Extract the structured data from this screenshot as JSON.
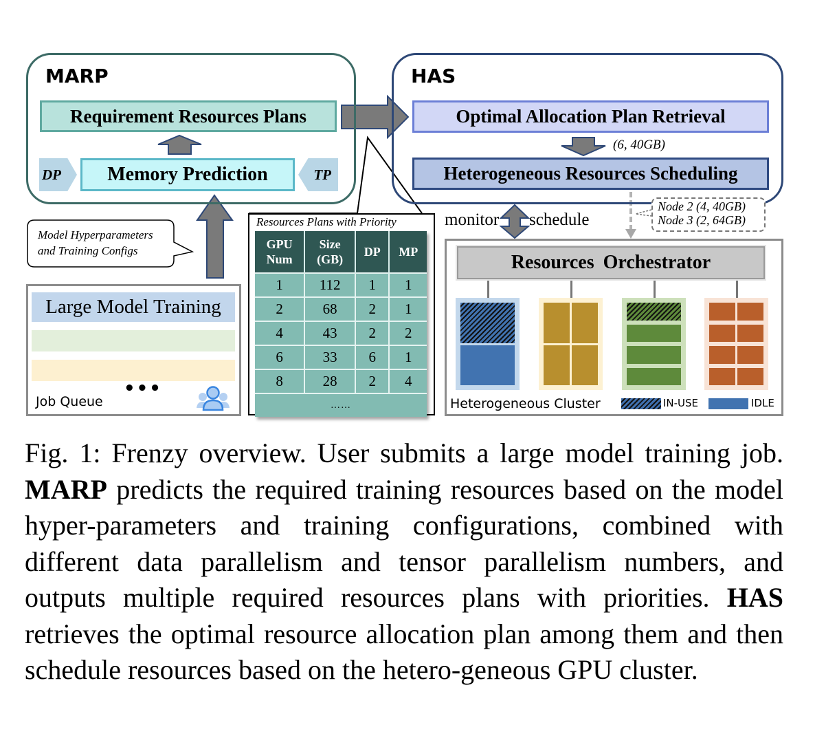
{
  "marp": {
    "title": "MARP",
    "requirement_plans": "Requirement Resources Plans",
    "memory_prediction": "Memory Prediction",
    "dp_tag": "DP",
    "tp_tag": "TP"
  },
  "has": {
    "title": "HAS",
    "optimal_plan": "Optimal Allocation Plan Retrieval",
    "selected_plan": "(6, 40GB)",
    "scheduling": "Heterogeneous Resources Scheduling"
  },
  "input_callout": {
    "line1": "Model Hyperparameters",
    "line2": "and Training Configs"
  },
  "job_queue": {
    "label": "Job Queue",
    "first_job": "Large Model Training",
    "more": "•••",
    "icon": "users-icon",
    "row_colors": [
      "#c2d6ec",
      "#e3efdb",
      "#fdf0d0"
    ]
  },
  "plans_table": {
    "caption": "Resources Plans with Priority",
    "headers": [
      [
        "GPU",
        "Num"
      ],
      [
        "Size",
        "(GB)"
      ],
      [
        "DP"
      ],
      [
        "MP"
      ]
    ],
    "rows": [
      [
        "1",
        "112",
        "1",
        "1"
      ],
      [
        "2",
        "68",
        "2",
        "1"
      ],
      [
        "4",
        "43",
        "2",
        "2"
      ],
      [
        "6",
        "33",
        "6",
        "1"
      ],
      [
        "8",
        "28",
        "2",
        "4"
      ]
    ],
    "more": "……"
  },
  "interaction": {
    "monitor": "monitor",
    "schedule": "schedule",
    "node_assignments": [
      "Node 2 (4, 40GB)",
      "Node 3 (2, 64GB)"
    ]
  },
  "cluster": {
    "orchestrator": "Resources  Orchestrator",
    "label": "Heterogeneous Cluster",
    "legend": {
      "in_use": "IN-USE",
      "idle": "IDLE"
    },
    "nodes": [
      {
        "name": "node-blue",
        "bg": "#c3d8ec",
        "color": "#4173b0",
        "cells": 2,
        "in_use": 1
      },
      {
        "name": "node-gold",
        "bg": "#fdf1d2",
        "color": "#b88f2e",
        "cells": 4,
        "in_use": 0
      },
      {
        "name": "node-green",
        "bg": "#cde0bb",
        "color": "#5e8a3b",
        "cells": 4,
        "in_use": 1
      },
      {
        "name": "node-orange",
        "bg": "#f8e3d6",
        "color": "#b95f2b",
        "cells": 8,
        "in_use": 0
      }
    ]
  },
  "caption": {
    "prefix": "Fig. 1: Frenzy overview. User submits a large model training job.",
    "marp": "MARP",
    "middle": "predicts the required training resources based on the model hyper-parameters and training configurations, combined with different data parallelism and tensor parallelism numbers, and outputs multiple required resources plans with priorities.",
    "has": "HAS",
    "suffix": "retrieves the optimal resource allocation plan among them and then schedule resources based on the hetero-geneous GPU cluster."
  }
}
